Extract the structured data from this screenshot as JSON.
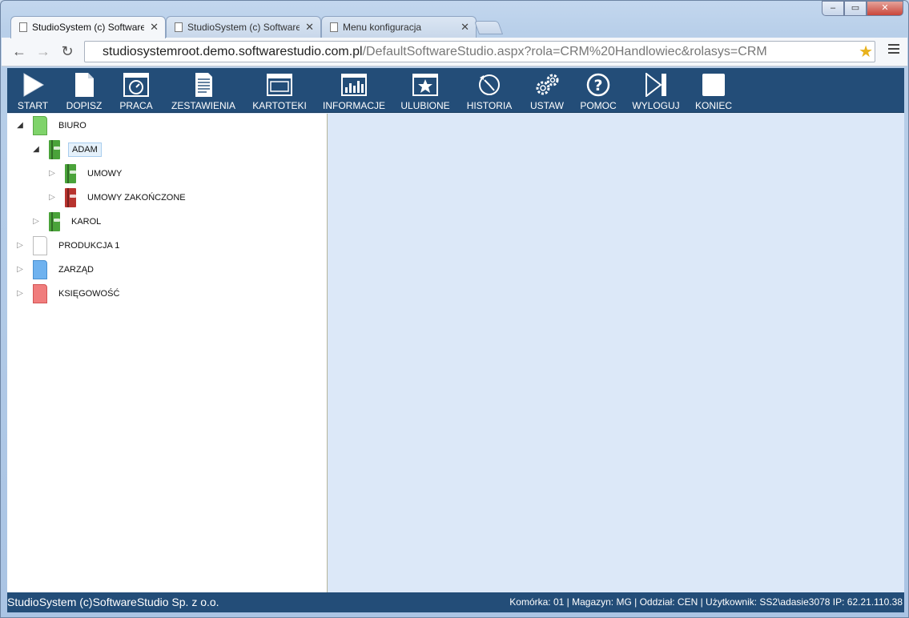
{
  "browser": {
    "tabs": [
      {
        "title": "StudioSystem (c) Software",
        "active": true
      },
      {
        "title": "StudioSystem (c) Software",
        "active": false
      },
      {
        "title": "Menu konfiguracja",
        "active": false
      }
    ],
    "window_controls": {
      "minimize": "–",
      "maximize": "▭",
      "close": "✕"
    },
    "nav": {
      "back": "←",
      "forward": "→",
      "reload": "↻"
    },
    "url_host": "studiosystemroot.demo.softwarestudio.com.pl",
    "url_path": "/DefaultSoftwareStudio.aspx?rola=CRM%20Handlowiec&rolasys=CRM",
    "bookmark_star": "★"
  },
  "toolbar": {
    "buttons": [
      {
        "id": "start",
        "label": "START",
        "icon": "play-icon"
      },
      {
        "id": "dopisz",
        "label": "DOPISZ",
        "icon": "new-doc-icon"
      },
      {
        "id": "praca",
        "label": "PRACA",
        "icon": "gauge-icon"
      },
      {
        "id": "zestawienia",
        "label": "ZESTAWIENIA",
        "icon": "report-icon"
      },
      {
        "id": "kartoteki",
        "label": "KARTOTEKI",
        "icon": "window-icon"
      },
      {
        "id": "informacje",
        "label": "INFORMACJE",
        "icon": "bar-chart-icon"
      },
      {
        "id": "ulubione",
        "label": "ULUBIONE",
        "icon": "star-icon"
      },
      {
        "id": "historia",
        "label": "HISTORIA",
        "icon": "history-icon"
      },
      {
        "id": "ustaw",
        "label": "USTAW",
        "icon": "gears-icon"
      },
      {
        "id": "pomoc",
        "label": "POMOC",
        "icon": "help-icon"
      },
      {
        "id": "wyloguj",
        "label": "WYLOGUJ",
        "icon": "skip-icon"
      },
      {
        "id": "koniec",
        "label": "KONIEC",
        "icon": "stop-icon"
      }
    ]
  },
  "tree": {
    "nodes": [
      {
        "label": "BIURO",
        "expander": "◢",
        "color": "#7fd36a"
      },
      {
        "label": "ADAM",
        "expander": "◢",
        "color": "#4aa33a"
      },
      {
        "label": "UMOWY",
        "expander": "▷",
        "color": "#4aa33a"
      },
      {
        "label": "UMOWY ZAKOŃCZONE",
        "expander": "▷",
        "color": "#b8332e"
      },
      {
        "label": "KAROL",
        "expander": "▷",
        "color": "#4aa33a"
      },
      {
        "label": "PRODUKCJA 1",
        "expander": "▷",
        "color": "#ffffff"
      },
      {
        "label": "ZARZĄD",
        "expander": "▷",
        "color": "#6fb2ef"
      },
      {
        "label": "KSIĘGOWOŚĆ",
        "expander": "▷",
        "color": "#f07d7d"
      }
    ]
  },
  "status": {
    "left": "StudioSystem (c)SoftwareStudio Sp. z o.o.",
    "right": "Komórka: 01 | Magazyn: MG | Oddział: CEN | Użytkownik: SS2\\adasie3078 IP: 62.21.110.38"
  }
}
